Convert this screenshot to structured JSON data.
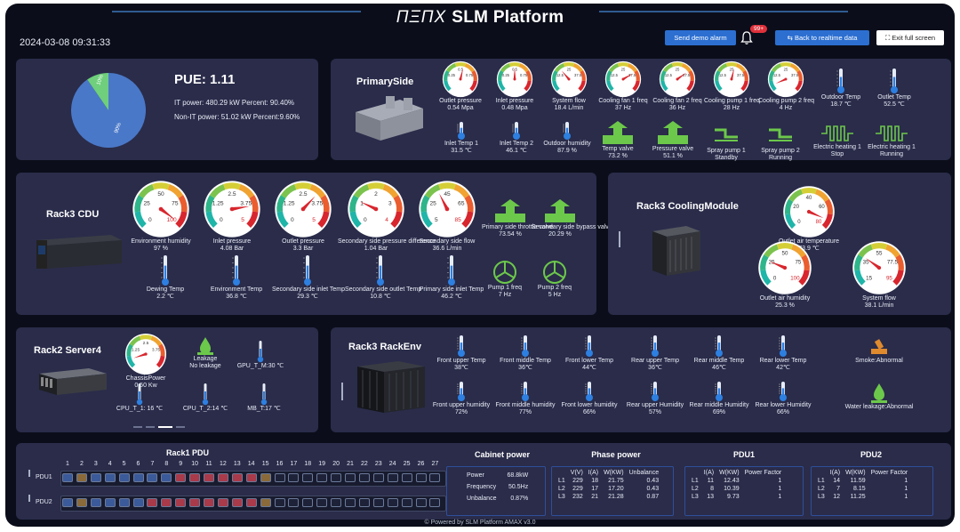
{
  "header": {
    "logo": "ΠΞΠX",
    "title": "SLM Platform",
    "datetime": "2024-03-08 09:31:33",
    "btn_demo": "Send demo alarm",
    "alarm_badge": "99+",
    "btn_back": "Back to realtime data",
    "btn_exit": "Exit full screen"
  },
  "pue": {
    "title": "PUE: 1.11",
    "it": "IT power: 480.29 kW Percent: 90.40%",
    "nonit": "Non-IT power: 51.02 kW Percent:9.60%",
    "pie_it_pct": 90.4,
    "pie_nonit_pct": 9.6,
    "pie_it_label": "90%",
    "pie_nonit_label": "10%"
  },
  "primary": {
    "title": "PrimarySide",
    "gauges": [
      {
        "label": "Outlet pressure",
        "value": "0.54 Mpa",
        "ticks": [
          "0.25",
          "0.5",
          "0.75"
        ],
        "frac": 0.55
      },
      {
        "label": "Inlet pressure",
        "value": "0.48 Mpa",
        "ticks": [
          "0.25",
          "0.5",
          "0.75"
        ],
        "frac": 0.5
      },
      {
        "label": "System flow",
        "value": "18.4 L/min",
        "ticks": [
          "12.5",
          "25",
          "37.5"
        ],
        "frac": 0.35
      },
      {
        "label": "Cooling fan 1 freq",
        "value": "37 Hz",
        "ticks": [
          "12.5",
          "25",
          "37.5"
        ],
        "frac": 0.72
      },
      {
        "label": "Cooling fan 2 freq",
        "value": "36 Hz",
        "ticks": [
          "12.5",
          "25",
          "37.5"
        ],
        "frac": 0.7
      },
      {
        "label": "Cooling pump 1 freq",
        "value": "28 Hz",
        "ticks": [
          "12.5",
          "25",
          "37.5"
        ],
        "frac": 0.55
      },
      {
        "label": "Cooling pump 2 freq",
        "value": "4 Hz",
        "ticks": [
          "12.5",
          "25",
          "37.5"
        ],
        "frac": 0.08
      }
    ],
    "outdoor_temp": {
      "label": "Outdoor Temp",
      "value": "18.7 ℃"
    },
    "outlet_temp": {
      "label": "Outlet Temp",
      "value": "52.5 ℃"
    },
    "row2": [
      {
        "label": "Inlet Temp 1",
        "value": "31.5 ℃",
        "type": "therm"
      },
      {
        "label": "Inlet Temp 2",
        "value": "46.1 ℃",
        "type": "therm"
      },
      {
        "label": "Outdoor humidity",
        "value": "87.9 %",
        "type": "therm"
      },
      {
        "label": "Temp valve",
        "value": "73.2 %",
        "type": "valve"
      },
      {
        "label": "Pressure valve",
        "value": "51.1 %",
        "type": "valve"
      },
      {
        "label": "Spray pump 1",
        "value": "Standby",
        "type": "pump"
      },
      {
        "label": "Spray pump 2",
        "value": "Running",
        "type": "pump"
      },
      {
        "label": "Electric heating 1",
        "value": "Stop",
        "type": "heat"
      },
      {
        "label": "Electric heating 1",
        "value": "Running",
        "type": "heat"
      }
    ]
  },
  "cdu": {
    "title": "Rack3 CDU",
    "gauges": [
      {
        "label": "Environment humidity",
        "value": "97 %",
        "ticks": [
          "25",
          "50",
          "75"
        ],
        "ends": [
          "0",
          "100"
        ],
        "frac": 0.97
      },
      {
        "label": "Inlet pressure",
        "value": "4.08 Bar",
        "ticks": [
          "1.25",
          "2.5",
          "3.75"
        ],
        "ends": [
          "0",
          "5"
        ],
        "frac": 0.8
      },
      {
        "label": "Outlet pressure",
        "value": "3.3 Bar",
        "ticks": [
          "1.25",
          "2.5",
          "3.75"
        ],
        "ends": [
          "0",
          "5"
        ],
        "frac": 0.66
      },
      {
        "label": "Secondary side pressure difference",
        "value": "1.04 Bar",
        "ticks": [
          "1",
          "2",
          "3"
        ],
        "ends": [
          "0",
          "4"
        ],
        "frac": 0.26
      },
      {
        "label": "Secondary side flow",
        "value": "36.6 L/min",
        "ticks": [
          "25",
          "45",
          "65"
        ],
        "ends": [
          "5",
          "85"
        ],
        "frac": 0.4
      }
    ],
    "valves": [
      {
        "label": "Primary side throttle valve",
        "value": "73.54 %"
      },
      {
        "label": "Secondary side bypass valve",
        "value": "20.29 %"
      }
    ],
    "therms": [
      {
        "label": "Dewing Temp",
        "value": "2.2 ℃"
      },
      {
        "label": "Environment Temp",
        "value": "36.8 ℃"
      },
      {
        "label": "Secondary side inlet Temp",
        "value": "29.3 ℃"
      },
      {
        "label": "Secondary side outlet Temp",
        "value": "10.8 ℃"
      },
      {
        "label": "Primary side inlet Temp",
        "value": "46.2 ℃"
      }
    ],
    "pumps": [
      {
        "label": "Pump 1 freq",
        "value": "7 Hz"
      },
      {
        "label": "Pump 2 freq",
        "value": "5 Hz"
      }
    ]
  },
  "cooling": {
    "title": "Rack3 CoolingModule",
    "outlet_temp": {
      "label": "Outlet air temperature",
      "value": "73.9 ℃",
      "ticks": [
        "20",
        "40",
        "60"
      ],
      "ends": [
        "0",
        "80"
      ],
      "frac": 0.92
    },
    "humidity": {
      "label": "Outlet air humidity",
      "value": "25.3 %",
      "ticks": [
        "25",
        "50",
        "75"
      ],
      "ends": [
        "0",
        "100"
      ],
      "frac": 0.25
    },
    "flow": {
      "label": "System flow",
      "value": "38.1 L/min",
      "ticks": [
        "35",
        "55",
        "77.5"
      ],
      "ends": [
        "15",
        "95"
      ],
      "frac": 0.3
    }
  },
  "server": {
    "title": "Rack2 Server4",
    "power": {
      "label": "ChassisPower",
      "value": "0.50 Kw",
      "ticks": [
        "1.25",
        "2.5",
        "3.75"
      ],
      "frac": 0.1
    },
    "leak_label": "Leakage",
    "leak_value": "No leakage",
    "gpu": "GPU_T_M:30 ℃",
    "cpu1": "CPU_T_1: 16 ℃",
    "cpu2": "CPU_T_2:14 ℃",
    "mb": "MB_T:17 ℃"
  },
  "rackenv": {
    "title": "Rack3 RackEnv",
    "temps": [
      {
        "label": "Front upper Temp",
        "value": "38℃"
      },
      {
        "label": "Front middle Temp",
        "value": "36℃"
      },
      {
        "label": "Front lower Temp",
        "value": "44℃"
      },
      {
        "label": "Rear upper Temp",
        "value": "36℃"
      },
      {
        "label": "Rear middle Temp",
        "value": "46℃"
      },
      {
        "label": "Rear lower Temp",
        "value": "42℃"
      }
    ],
    "hums": [
      {
        "label": "Front upper humidity",
        "value": "72%"
      },
      {
        "label": "Front middle humidity",
        "value": "77%"
      },
      {
        "label": "Front lower humidity",
        "value": "66%"
      },
      {
        "label": "Rear upper Humidity",
        "value": "57%"
      },
      {
        "label": "Rear middle Humidity",
        "value": "69%"
      },
      {
        "label": "Rear lower Humidity",
        "value": "66%"
      }
    ],
    "smoke": "Smoke:Abnormal",
    "water": "Water leakage:Abnormal"
  },
  "pdu": {
    "title": "Rack1 PDU",
    "ports": [
      "1",
      "2",
      "3",
      "4",
      "5",
      "6",
      "7",
      "8",
      "9",
      "10",
      "11",
      "12",
      "13",
      "14",
      "15",
      "16",
      "17",
      "18",
      "19",
      "20",
      "21",
      "22",
      "23",
      "24",
      "25",
      "26",
      "27"
    ],
    "row1_label": "PDU1",
    "row2_label": "PDU2",
    "row1_colors": [
      "#3b5a9a",
      "#8a6a3a",
      "#3b5a9a",
      "#3b5a9a",
      "#3b5a9a",
      "#3b5a9a",
      "#3b5a9a",
      "#3b5a9a",
      "#a83a4a",
      "#a83a4a",
      "#a83a4a",
      "#a83a4a",
      "#a83a4a",
      "#a83a4a",
      "#8a6a3a",
      "#1e2238",
      "#1e2238",
      "#1e2238",
      "#1e2238",
      "#1e2238",
      "#1e2238",
      "#1e2238",
      "#1e2238",
      "#1e2238",
      "#1e2238",
      "#1e2238",
      "#1e2238"
    ],
    "row2_colors": [
      "#3b5a9a",
      "#8a6a3a",
      "#3b5a9a",
      "#3b5a9a",
      "#3b5a9a",
      "#3b5a9a",
      "#a83a4a",
      "#a83a4a",
      "#a83a4a",
      "#a83a4a",
      "#a83a4a",
      "#a83a4a",
      "#a83a4a",
      "#a83a4a",
      "#8a6a3a",
      "#1e2238",
      "#1e2238",
      "#1e2238",
      "#1e2238",
      "#1e2238",
      "#1e2238",
      "#1e2238",
      "#1e2238",
      "#1e2238",
      "#1e2238",
      "#1e2238",
      "#1e2238"
    ]
  },
  "cabinet": {
    "title": "Cabinet power",
    "rows": [
      [
        "Power",
        "68.8kW"
      ],
      [
        "Frequency",
        "50.5Hz"
      ],
      [
        "Unbalance",
        "0.87%"
      ]
    ]
  },
  "phase": {
    "title": "Phase power",
    "header": [
      "",
      "V(V)",
      "I(A)",
      "W(KW)",
      "Unbalance"
    ],
    "rows": [
      [
        "L1",
        "229",
        "18",
        "21.75",
        "0.43"
      ],
      [
        "L2",
        "229",
        "17",
        "17.20",
        "0.43"
      ],
      [
        "L3",
        "232",
        "21",
        "21.28",
        "0.87"
      ]
    ]
  },
  "pdu1": {
    "title": "PDU1",
    "header": [
      "",
      "I(A)",
      "W(KW)",
      "Power Factor"
    ],
    "rows": [
      [
        "L1",
        "11",
        "12.43",
        "1"
      ],
      [
        "L2",
        "8",
        "10.39",
        "1"
      ],
      [
        "L3",
        "13",
        "9.73",
        "1"
      ]
    ]
  },
  "pdu2": {
    "title": "PDU2",
    "header": [
      "",
      "I(A)",
      "W(KW)",
      "Power Factor"
    ],
    "rows": [
      [
        "L1",
        "14",
        "11.59",
        "1"
      ],
      [
        "L2",
        "7",
        "8.15",
        "1"
      ],
      [
        "L3",
        "12",
        "11.25",
        "1"
      ]
    ]
  },
  "footer": "© Powered by SLM Platform AMAX v3.0"
}
